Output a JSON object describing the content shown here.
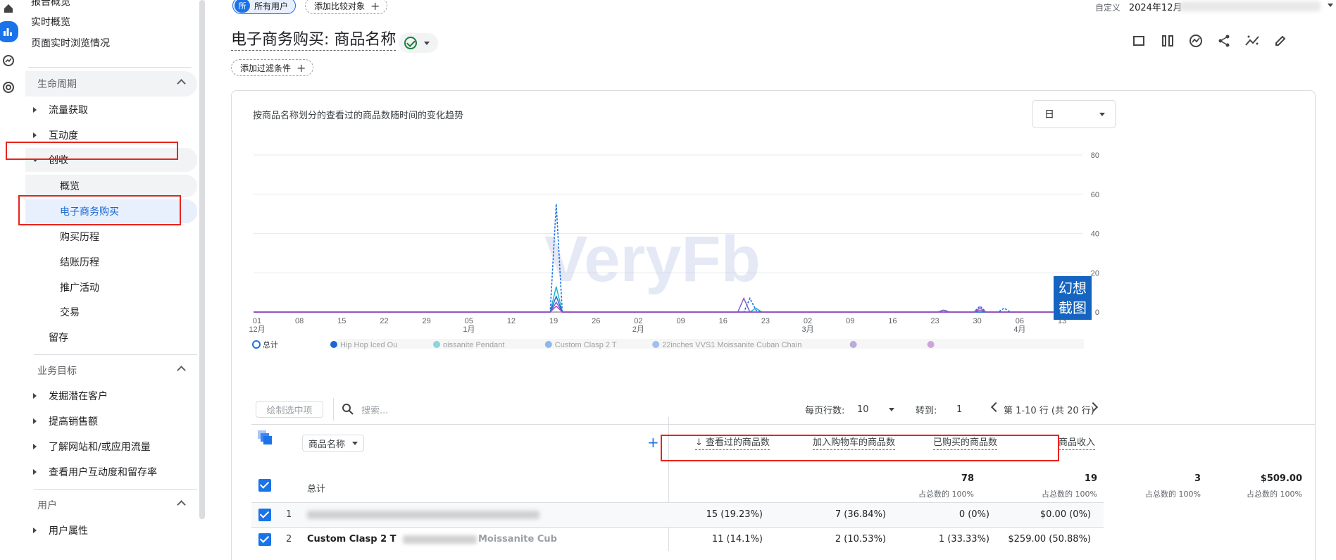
{
  "sidebar": {
    "top_items": [
      "报告概览",
      "实时概览",
      "页面实时浏览情况"
    ],
    "sections": [
      {
        "label": "生命周期",
        "items": [
          {
            "label": "流量获取"
          },
          {
            "label": "互动度"
          },
          {
            "label": "创收",
            "expanded": true,
            "children": [
              "概览",
              "电子商务购买",
              "购买历程",
              "结账历程",
              "推广活动",
              "交易"
            ]
          },
          {
            "label": "留存"
          }
        ]
      },
      {
        "label": "业务目标",
        "items": [
          {
            "label": "发掘潜在客户"
          },
          {
            "label": "提高销售额"
          },
          {
            "label": "了解网站和/或应用流量"
          },
          {
            "label": "查看用户互动度和留存率"
          }
        ]
      },
      {
        "label": "用户",
        "items": [
          {
            "label": "用户属性"
          }
        ]
      }
    ],
    "active_item": "电子商务购买"
  },
  "header": {
    "segment_badge": "所",
    "segment_label": "所有用户",
    "compare_label": "添加比较对象",
    "date_prefix": "自定义",
    "date_value": "2024年12月",
    "title": "电子商务购买: 商品名称",
    "filter_label": "添加过滤条件"
  },
  "toolbar_icons": [
    "comment-icon",
    "compare-icon",
    "insights-icon",
    "share-icon",
    "trend-icon",
    "edit-icon"
  ],
  "chart": {
    "title": "按商品名称划分的查看过的商品数随时间的变化趋势",
    "granularity": "日",
    "watermark": "VeryFb",
    "stamp": "幻想截图",
    "legend": [
      {
        "label": "总计",
        "color": "#1a73e8",
        "style": "hollow"
      },
      {
        "label": "Hip Hop Iced Ou",
        "color": "#1967d2"
      },
      {
        "label": "oissanite Pendant",
        "color": "#12b5cb"
      },
      {
        "label": "Custom Clasp 2 T",
        "color": "#1a73e8"
      },
      {
        "label": "22inches VVS1 Moissanite Cuban Chain",
        "color": "#4285f4"
      },
      {
        "label": "",
        "color": "#7e57c2"
      },
      {
        "label": "",
        "color": "#ab47bc"
      }
    ]
  },
  "chart_data": {
    "type": "line",
    "title": "按商品名称划分的查看过的商品数随时间的变化趋势",
    "x_ticks": [
      {
        "day": "01",
        "month": "12月"
      },
      {
        "day": "08",
        "month": ""
      },
      {
        "day": "15",
        "month": ""
      },
      {
        "day": "22",
        "month": ""
      },
      {
        "day": "29",
        "month": ""
      },
      {
        "day": "05",
        "month": "1月"
      },
      {
        "day": "12",
        "month": ""
      },
      {
        "day": "19",
        "month": ""
      },
      {
        "day": "26",
        "month": ""
      },
      {
        "day": "02",
        "month": "2月"
      },
      {
        "day": "09",
        "month": ""
      },
      {
        "day": "16",
        "month": ""
      },
      {
        "day": "23",
        "month": ""
      },
      {
        "day": "02",
        "month": "3月"
      },
      {
        "day": "09",
        "month": ""
      },
      {
        "day": "16",
        "month": ""
      },
      {
        "day": "23",
        "month": ""
      },
      {
        "day": "30",
        "month": ""
      },
      {
        "day": "06",
        "month": "4月"
      },
      {
        "day": "13",
        "month": ""
      }
    ],
    "y_ticks": [
      0,
      20,
      40,
      60,
      80
    ],
    "ylim": [
      0,
      80
    ],
    "x_count": 137,
    "series": [
      {
        "name": "总计",
        "color": "#1a73e8",
        "dashed": true,
        "points": [
          [
            49,
            0
          ],
          [
            50,
            55
          ],
          [
            51,
            0
          ],
          [
            81,
            0
          ],
          [
            82,
            7
          ],
          [
            83,
            1
          ],
          [
            84,
            0
          ],
          [
            113,
            0
          ],
          [
            114,
            1
          ],
          [
            115,
            0
          ],
          [
            119,
            0
          ],
          [
            120,
            3
          ],
          [
            121,
            0
          ],
          [
            123,
            0
          ],
          [
            124,
            2
          ],
          [
            125,
            0
          ]
        ]
      },
      {
        "name": "",
        "color": "#12b5cb",
        "dashed": false,
        "points": [
          [
            49,
            0
          ],
          [
            50,
            13
          ],
          [
            51,
            0
          ],
          [
            82,
            0
          ],
          [
            83,
            2
          ],
          [
            84,
            0
          ]
        ]
      },
      {
        "name": "",
        "color": "#1967d2",
        "dashed": false,
        "points": [
          [
            49,
            0
          ],
          [
            50,
            8
          ],
          [
            51,
            0
          ]
        ]
      },
      {
        "name": "",
        "color": "#7e57c2",
        "dashed": false,
        "points": [
          [
            49,
            0
          ],
          [
            50,
            5
          ],
          [
            51,
            0
          ],
          [
            80,
            0
          ],
          [
            81,
            7
          ],
          [
            82,
            0
          ],
          [
            113,
            0
          ],
          [
            114,
            1
          ],
          [
            115,
            0
          ],
          [
            119,
            0
          ],
          [
            120,
            1
          ],
          [
            121,
            0
          ]
        ]
      },
      {
        "name": "",
        "color": "#ab47bc",
        "dashed": false,
        "points": [
          [
            49,
            0
          ],
          [
            50,
            3
          ],
          [
            51,
            0
          ],
          [
            119,
            0
          ],
          [
            120,
            2
          ],
          [
            121,
            0
          ]
        ]
      }
    ]
  },
  "table_toolbar": {
    "plot_button": "绘制选中项",
    "search_placeholder": "搜索...",
    "rows_per_page_label": "每页行数:",
    "rows_per_page_value": "10",
    "goto_label": "转到:",
    "goto_value": "1",
    "page_range": "第 1-10 行 (共 20 行)"
  },
  "table": {
    "dimension_label": "商品名称",
    "columns": [
      "查看过的商品数",
      "加入购物车的商品数",
      "已购买的商品数",
      "商品收入"
    ],
    "sort_column": "查看过的商品数",
    "total": {
      "label": "总计",
      "values": [
        "78",
        "19",
        "3",
        "$509.00"
      ],
      "subs": [
        "占总数的 100%",
        "占总数的 100%",
        "占总数的 100%",
        "占总数的 100%"
      ]
    },
    "rows": [
      {
        "index": "1",
        "name": "",
        "values": [
          "15 (19.23%)",
          "7 (36.84%)",
          "0 (0%)",
          "$0.00 (0%)"
        ]
      },
      {
        "index": "2",
        "name": "Custom Clasp 2 T",
        "name_tail": "Moissanite Cub",
        "values": [
          "11 (14.1%)",
          "2 (10.53%)",
          "1 (33.33%)",
          "$259.00 (50.88%)"
        ]
      }
    ]
  }
}
